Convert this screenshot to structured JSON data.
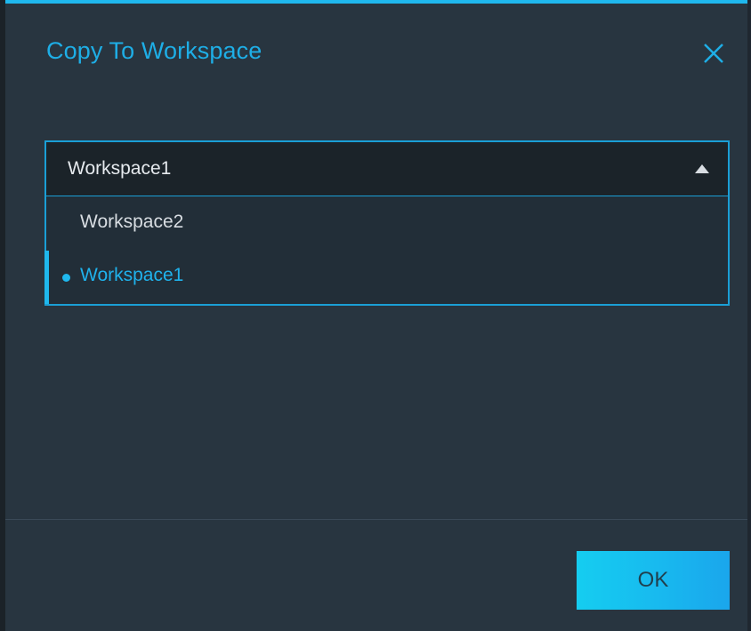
{
  "dialog": {
    "title": "Copy To Workspace",
    "close_icon": "close-icon"
  },
  "workspace_select": {
    "selected_value": "Workspace1",
    "expanded": true,
    "caret_icon": "caret-up-icon",
    "options": [
      {
        "label": "Workspace2",
        "selected": false
      },
      {
        "label": "Workspace1",
        "selected": true
      }
    ]
  },
  "footer": {
    "ok_label": "OK"
  },
  "colors": {
    "accent": "#1fb8ee",
    "dialog_bg": "#283540",
    "select_bg": "#1b2329",
    "button_bg": "#18b9ef"
  }
}
